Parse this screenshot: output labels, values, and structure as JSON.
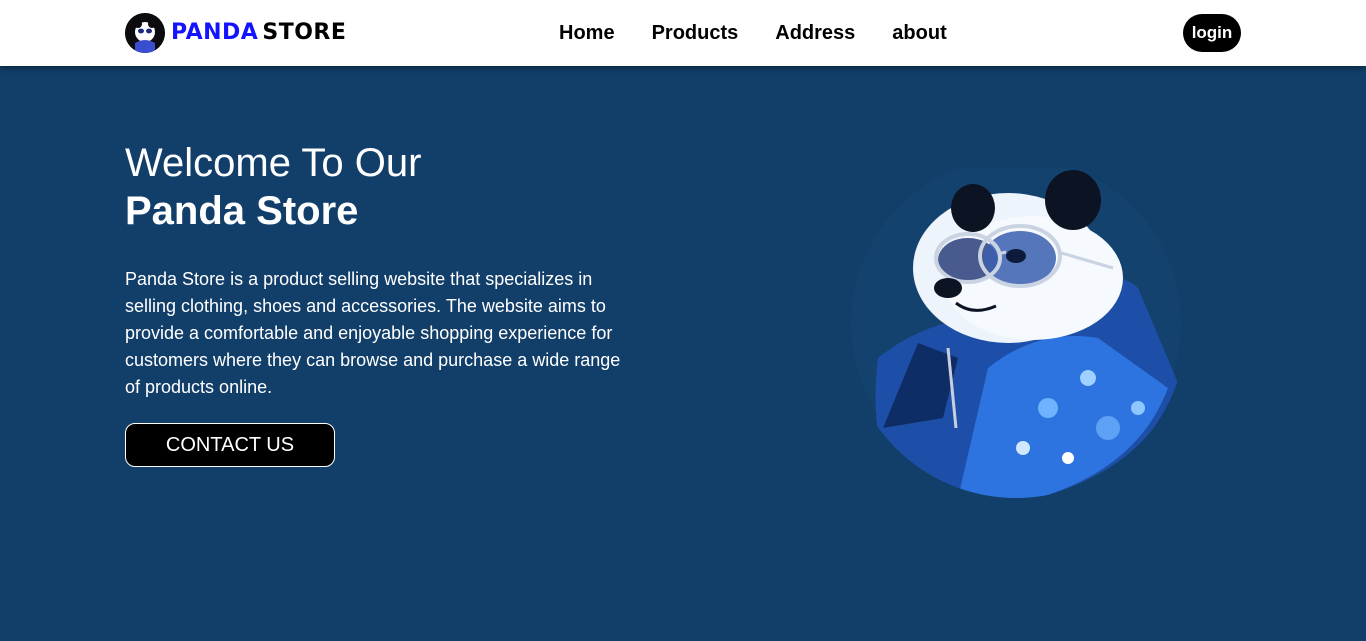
{
  "brand": {
    "logo_icon": "panda-logo-icon",
    "name_part1": "PANDA",
    "name_part2": "STORE"
  },
  "nav": {
    "items": [
      {
        "label": "Home"
      },
      {
        "label": "Products"
      },
      {
        "label": "Address"
      },
      {
        "label": "about"
      }
    ],
    "login_label": "login"
  },
  "hero": {
    "title_line1": "Welcome To Our",
    "title_line2": "Panda Store",
    "description": "Panda Store is a product selling website that specializes in selling clothing, shoes and accessories. The website aims to provide a comfortable and enjoyable shopping experience for customers where they can browse and purchase a wide range of products online.",
    "cta_label": "CONTACT US",
    "image_icon": "panda-illustration"
  },
  "colors": {
    "background": "#123f6a",
    "navbar": "#ffffff",
    "brand_blue": "#1313ff",
    "button": "#000000"
  }
}
